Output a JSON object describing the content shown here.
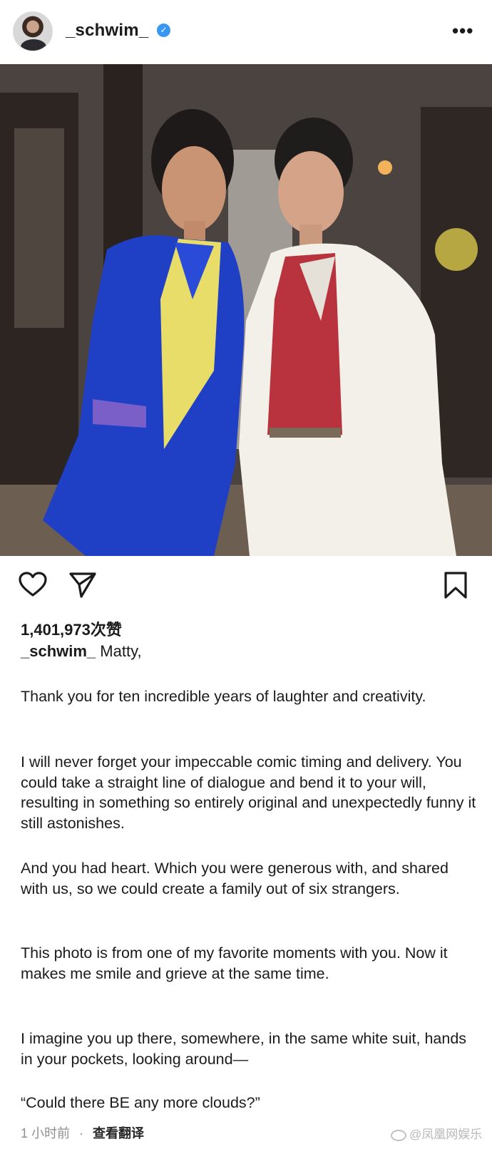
{
  "post": {
    "username": "_schwim_",
    "verified_mark": "✓",
    "more_menu": "•••"
  },
  "icons": {
    "like": "heart-icon",
    "share": "send-icon",
    "save": "bookmark-icon"
  },
  "likes_text": "1,401,973次赞",
  "caption": {
    "username": "_schwim_",
    "opening": "Matty,",
    "paragraphs": [
      "Thank you for ten incredible years of laughter and creativity.",
      "I will never forget your impeccable comic timing and delivery. You could take a straight line of dialogue and bend it to your will, resulting in something so entirely original and unexpectedly funny it still astonishes.",
      "And you had heart. Which you were generous with, and shared with us, so we could create a family out of six strangers.",
      "This photo is from one of my favorite moments with you. Now it makes me smile and grieve at the same time.",
      "I imagine you up there, somewhere, in the same white suit, hands in your pockets, looking around—",
      "“Could there BE any more clouds?”"
    ]
  },
  "footer": {
    "timestamp": "1 小时前",
    "separator": "·",
    "translate": "查看翻译"
  },
  "watermark": "@凤凰网娱乐",
  "colors": {
    "verified": "#3897f0",
    "blue_suit": "#1f3fc4",
    "white_suit": "#f3f0ea",
    "red_shirt": "#b8333d",
    "yellow_shirt": "#e9dd6a"
  }
}
